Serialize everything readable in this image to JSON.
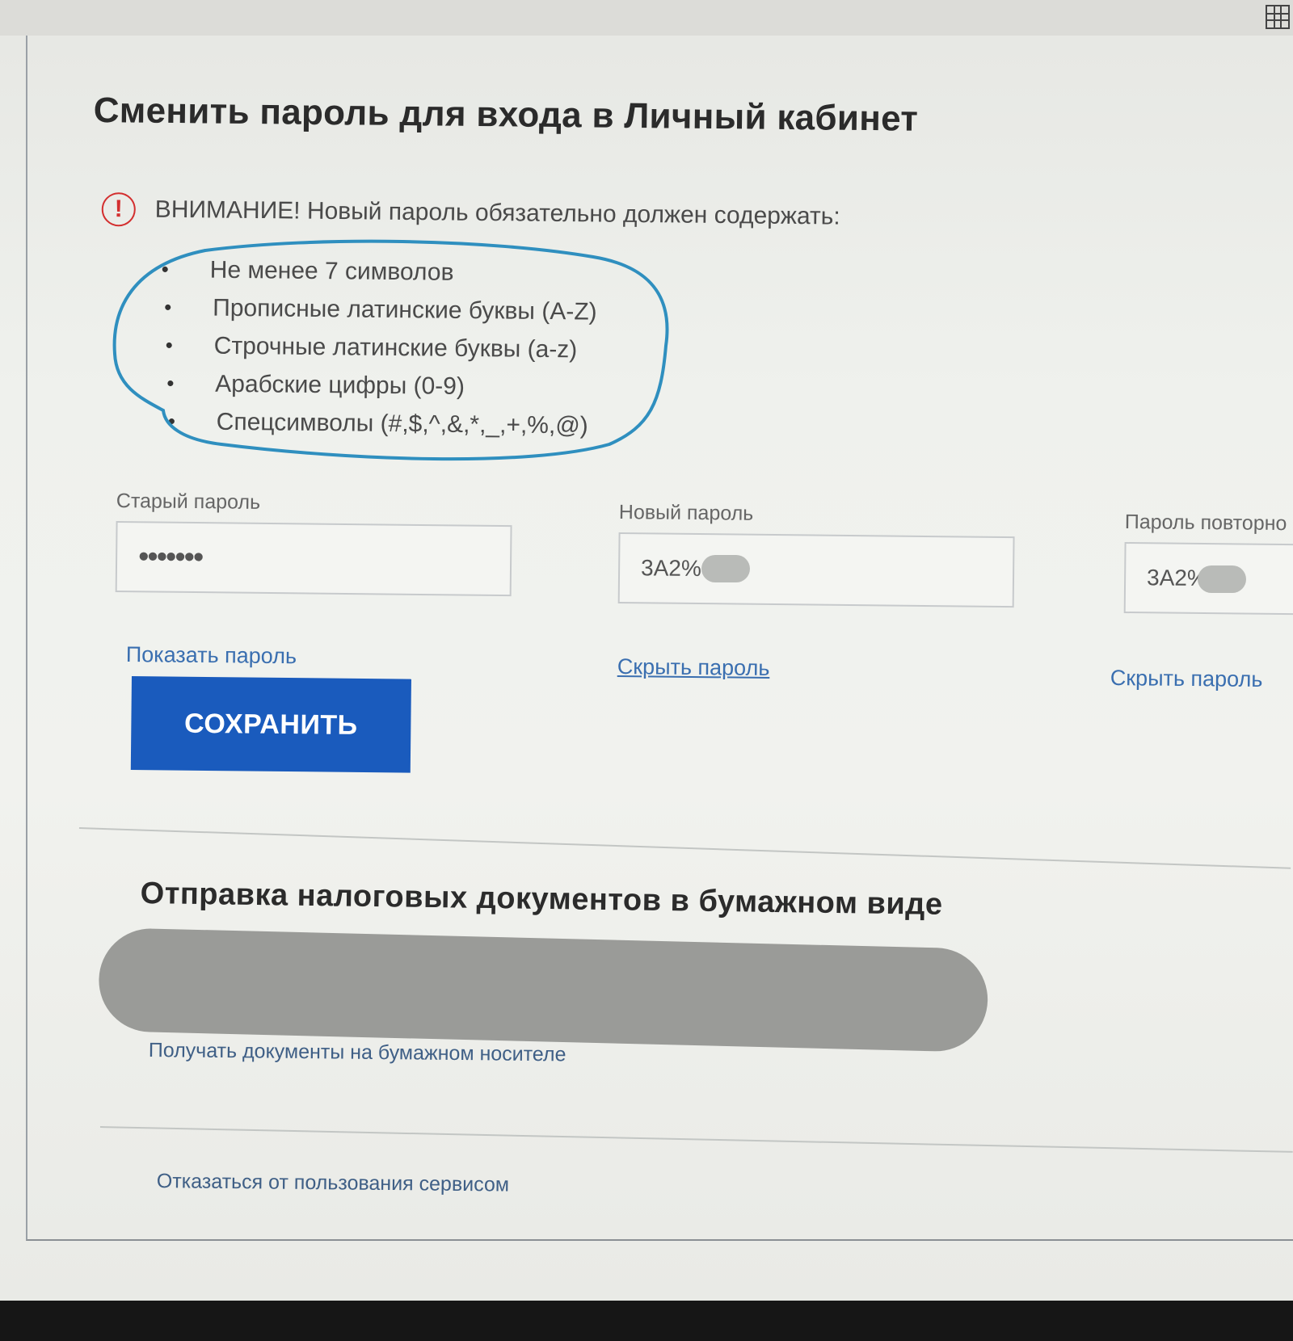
{
  "page": {
    "title": "Сменить пароль для входа в Личный кабинет"
  },
  "warning": {
    "icon": "!",
    "text": "ВНИМАНИЕ! Новый пароль обязательно должен содержать:"
  },
  "requirements": [
    "Не менее 7 символов",
    "Прописные латинские буквы (A-Z)",
    "Строчные латинские буквы (a-z)",
    "Арабские цифры (0-9)",
    "Спецсимволы (#,$,^,&,*,_,+,%,@)"
  ],
  "fields": {
    "old": {
      "label": "Старый пароль",
      "value": "•••••••"
    },
    "new": {
      "label": "Новый пароль",
      "value": "3A2%"
    },
    "repeat": {
      "label": "Пароль повторно",
      "value": "3A2%"
    }
  },
  "links": {
    "show_old": "Показать пароль",
    "hide_new": "Скрыть пароль",
    "hide_repeat": "Скрыть пароль"
  },
  "save_button": "СОХРАНИТЬ",
  "paper": {
    "title": "Отправка налоговых документов в бумажном виде",
    "link": "Получать документы на бумажном носителе"
  },
  "refuse_link": "Отказаться от пользования сервисом",
  "colors": {
    "accent": "#1a5bbd",
    "warning": "#d32f2f",
    "link": "#3a6fb0",
    "marker": "#2f8fbf"
  }
}
